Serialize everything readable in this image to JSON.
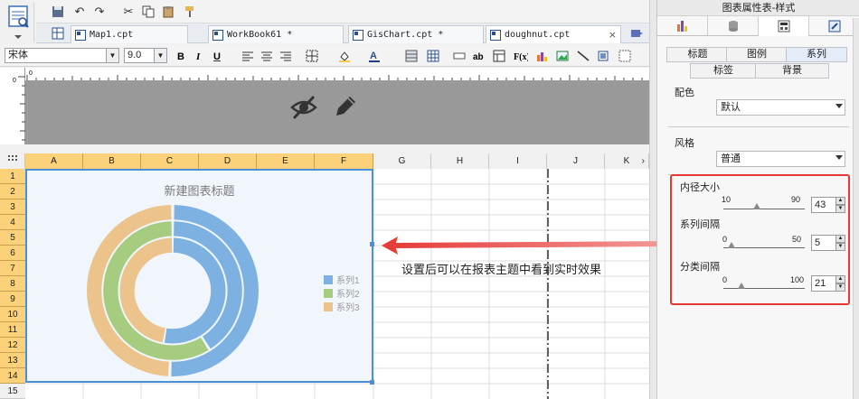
{
  "toolbar": {
    "tabs": [
      {
        "label": "Map1.cpt"
      },
      {
        "label": "WorkBook61 *"
      },
      {
        "label": "GisChart.cpt *"
      },
      {
        "label": "doughnut.cpt",
        "active": true
      }
    ],
    "tab_close": "×",
    "font_name": "宋体",
    "font_size": "9.0"
  },
  "sheet": {
    "columns": [
      "A",
      "B",
      "C",
      "D",
      "E",
      "F",
      "G",
      "H",
      "I",
      "J",
      "K"
    ],
    "rows": [
      "1",
      "2",
      "3",
      "4",
      "5",
      "6",
      "7",
      "8",
      "9",
      "10",
      "11",
      "12",
      "13",
      "14",
      "15"
    ]
  },
  "chart_data": {
    "type": "pie",
    "title": "新建图表标题",
    "inner_radius_percent": 43,
    "series_gap": 5,
    "category_gap": 21,
    "legend_position": "right",
    "series": [
      {
        "name": "系列1",
        "color": "#7cb1e2"
      },
      {
        "name": "系列2",
        "color": "#a6cc80"
      },
      {
        "name": "系列3",
        "color": "#ecc38a"
      }
    ]
  },
  "annotation": {
    "text": "设置后可以在报表主题中看到实时效果",
    "color": "#e53935"
  },
  "panel": {
    "title": "图表属性表-样式",
    "tabs_row1": [
      "标题",
      "图例",
      "系列"
    ],
    "tabs_row2": [
      "标签",
      "背景"
    ],
    "active_tab": "系列",
    "color_label": "配色",
    "color_value": "默认",
    "style_label": "风格",
    "style_value": "普通",
    "inner_size": {
      "label": "内径大小",
      "min": "10",
      "max": "90",
      "value": "43"
    },
    "series_gap": {
      "label": "系列间隔",
      "min": "0",
      "max": "50",
      "value": "5"
    },
    "category_gap": {
      "label": "分类间隔",
      "min": "0",
      "max": "100",
      "value": "21"
    }
  }
}
